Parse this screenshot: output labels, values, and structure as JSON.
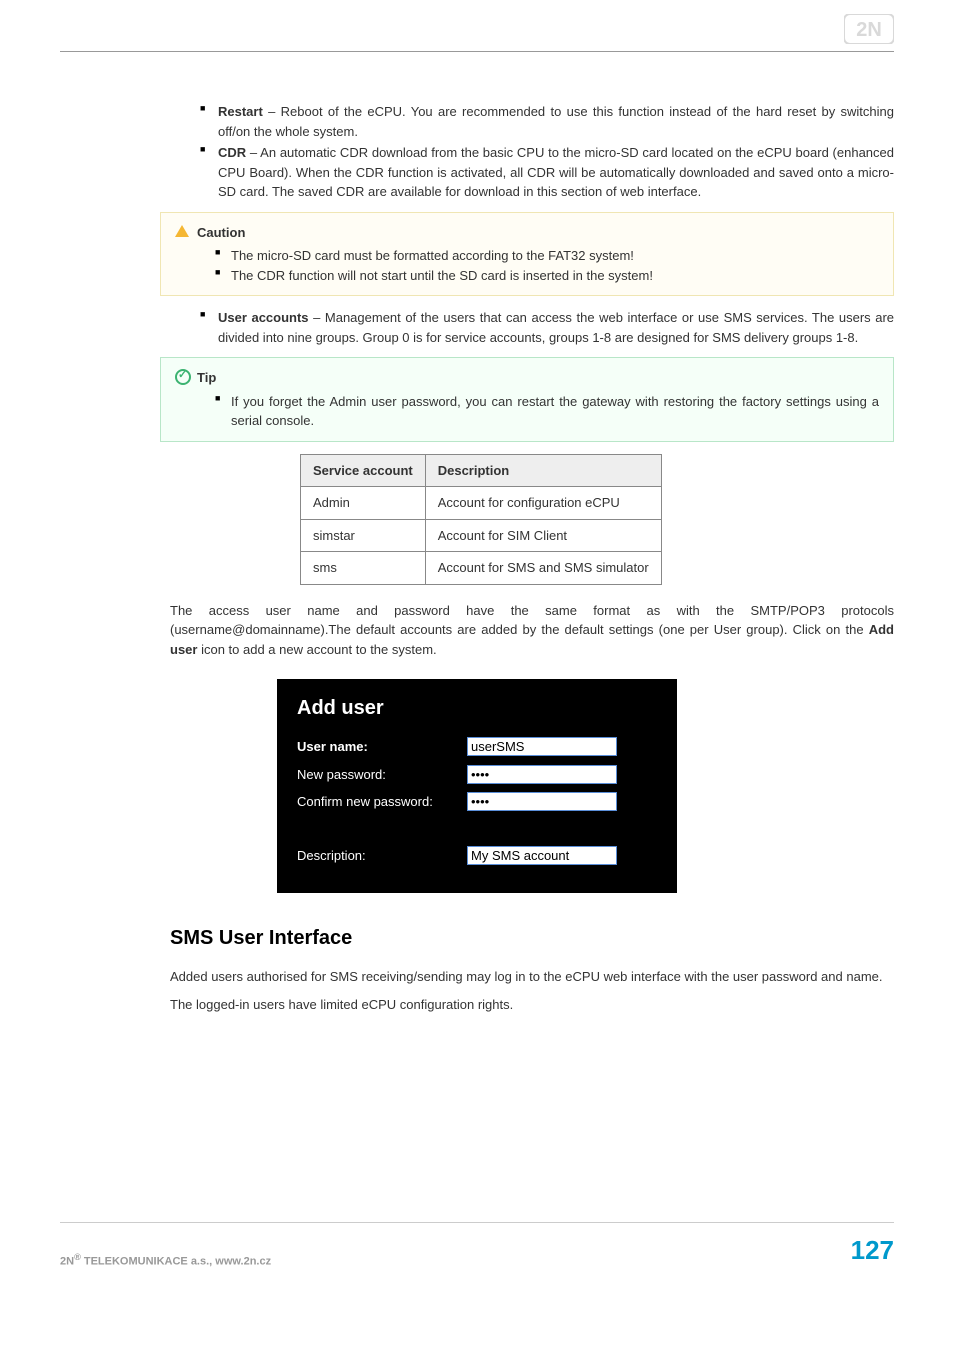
{
  "bullets": {
    "restart": {
      "title": "Restart",
      "text": " – Reboot of the eCPU. You are recommended to use this function instead of the hard reset by switching off/on the whole system."
    },
    "cdr": {
      "title": "CDR",
      "text": " – An automatic CDR download from the basic CPU to the micro-SD card located on the eCPU board (enhanced CPU Board). When the CDR function is activated, all CDR will be automatically downloaded and saved onto a micro-SD card. The saved CDR are available for download in this section of web interface."
    },
    "user_accounts": {
      "title": "User accounts",
      "text": " – Management of the users that can access the web interface or use SMS services. The users are divided into nine groups. Group 0 is for service accounts, groups 1-8 are designed for SMS delivery groups 1-8."
    }
  },
  "caution": {
    "title": "Caution",
    "items": [
      "The micro-SD card must be formatted according to the FAT32 system!",
      "The CDR function will not start until the SD card is inserted in the system!"
    ]
  },
  "tip": {
    "title": "Tip",
    "items": [
      "If you forget the Admin user password, you can restart the gateway with restoring the factory settings using a serial console."
    ]
  },
  "svc_table": {
    "headers": [
      "Service account",
      "Description"
    ],
    "rows": [
      [
        "Admin",
        "Account for configuration eCPU"
      ],
      [
        "simstar",
        "Account for SIM Client"
      ],
      [
        "sms",
        "Account for SMS and SMS simulator"
      ]
    ]
  },
  "para1_a": "The access user name and password have the same format as with the SMTP/POP3 protocols (username@domainname).The default accounts are added by the default settings (one per User group). Click on the ",
  "para1_bold": "Add user",
  "para1_b": " icon to add a new account to the system.",
  "add_user": {
    "heading": "Add user",
    "labels": {
      "username": "User name:",
      "newpass": "New password:",
      "confirm": "Confirm new password:",
      "description": "Description:"
    },
    "values": {
      "username": "userSMS",
      "newpass": "••••",
      "confirm": "••••",
      "description": "My SMS account"
    }
  },
  "section_heading": "SMS User Interface",
  "para2": "Added users authorised for SMS receiving/sending may log in to the eCPU web interface with the user password and name.",
  "para3": "The logged-in users have limited eCPU configuration rights.",
  "footer": {
    "left_a": "2N",
    "left_sup": "®",
    "left_b": " TELEKOMUNIKACE a.s., www.2n.cz",
    "page": "127"
  }
}
